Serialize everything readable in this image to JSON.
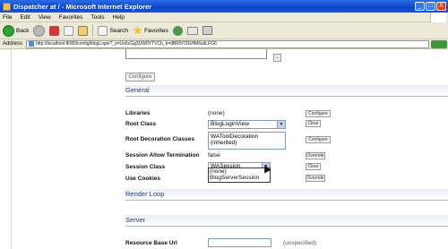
{
  "window": {
    "title": "Dispatcher at / - Microsoft Internet Explorer",
    "buttons": [
      "_",
      "□",
      "X"
    ]
  },
  "menu": [
    "File",
    "Edit",
    "View",
    "Favorites",
    "Tools",
    "Help"
  ],
  "toolbar": {
    "back_label": "Back",
    "search_label": "Search",
    "favorites_label": "Favorites"
  },
  "address": {
    "label": "Address",
    "url": "http://localhost:8080/config/blogLogin?_s=Uo6cGg3UW0YTVCb_k=dBR5I73GHM6sdLFG0"
  },
  "page": {
    "configure_button": "Configure",
    "topfield_button": "...",
    "sections": {
      "general": "General",
      "render_loop": "Render Loop",
      "server": "Server"
    },
    "rows": [
      {
        "label": "Libraries",
        "value": "(none)",
        "buttons": [
          "Configure",
          "Clear"
        ]
      },
      {
        "label": "Root Class",
        "value": "BlogLoginView",
        "buttons": [
          "Clear"
        ]
      },
      {
        "label": "Root Decoration Classes",
        "value": "WAToolDecoration (inherited)",
        "buttons": [
          "Configure"
        ]
      },
      {
        "label": "Session Allow Termination",
        "value": "false",
        "buttons": [
          "Override"
        ]
      },
      {
        "label": "Session Class",
        "value": "WASession",
        "buttons": [
          "Clear"
        ]
      },
      {
        "label": "Use Cookies",
        "value": "",
        "buttons": [
          "Override"
        ]
      }
    ],
    "session_dropdown_options": [
      "(none)",
      "BlogServerSession"
    ],
    "resource_base_url": {
      "label": "Resource Base Url",
      "value": "",
      "note": "(unspecified)"
    }
  }
}
